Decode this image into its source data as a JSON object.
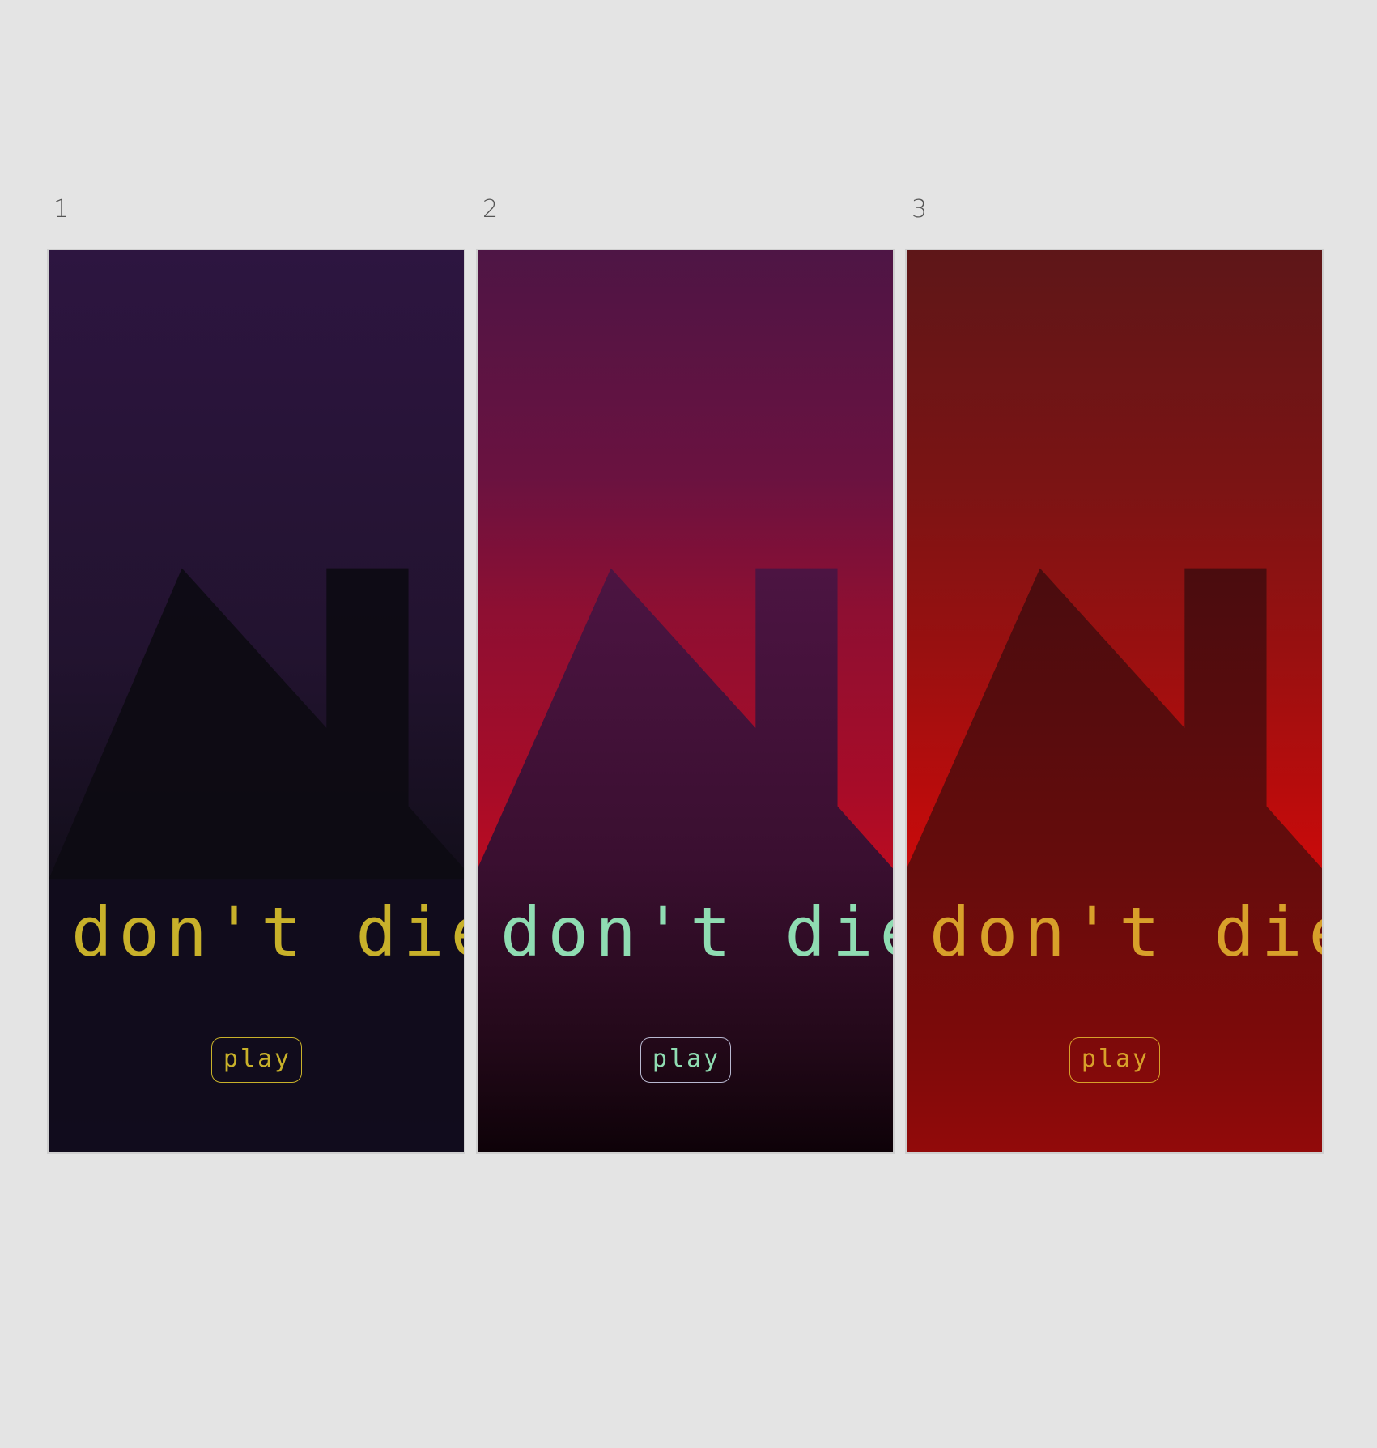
{
  "artboards": [
    {
      "number": "1",
      "title": "don't die.",
      "button_label": "play",
      "colors": {
        "bg_top": "#2d1540",
        "bg_bottom": "#180f26",
        "house": "#0d0b12",
        "accent": "#c8b12a"
      }
    },
    {
      "number": "2",
      "title": "don't die.",
      "button_label": "play",
      "colors": {
        "bg_top": "#4e1545",
        "bg_mid": "#8e0f32",
        "bg_bottom": "#c10b1e",
        "house_top": "#4c1442",
        "house_bottom": "#0e0208",
        "accent": "#8fdcb2",
        "button_border": "#b8b8d0"
      }
    },
    {
      "number": "3",
      "title": "don't die.",
      "button_label": "play",
      "colors": {
        "bg_top": "#5e1618",
        "bg_bottom": "#d10a0a",
        "house_top": "#4a0c0e",
        "house_bottom": "#920a0a",
        "accent": "#d8a02a"
      }
    }
  ]
}
